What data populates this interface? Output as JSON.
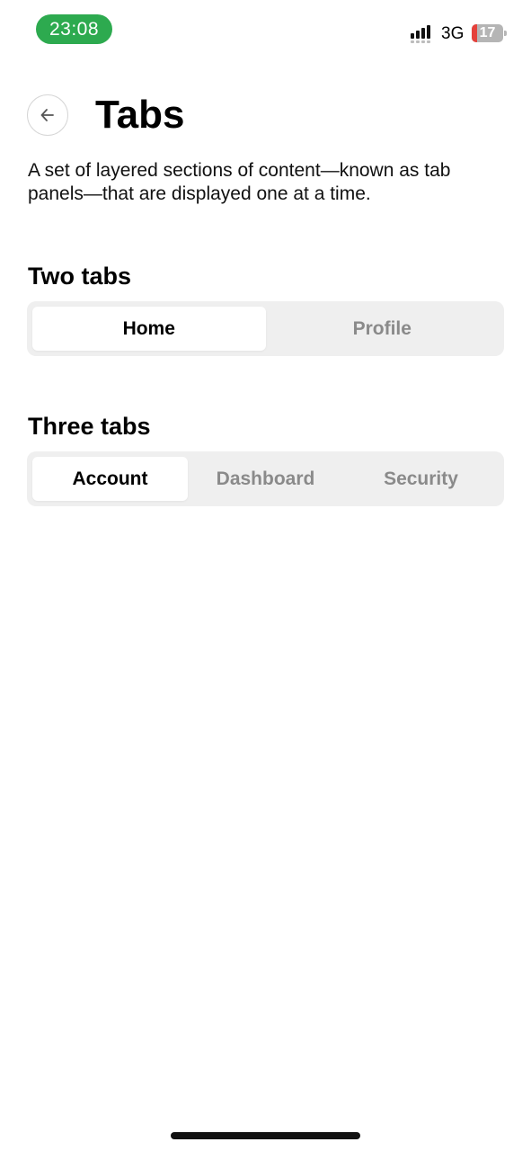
{
  "status_bar": {
    "time": "23:08",
    "network": "3G",
    "battery_level": "17",
    "battery_fraction": 0.17,
    "colors": {
      "time_pill": "#2daa4f",
      "battery_low": "#e5413b"
    }
  },
  "header": {
    "back_icon": "arrow-left-icon",
    "title": "Tabs"
  },
  "description": "A set of layered sections of content—known as tab panels—that are displayed one at a time.",
  "two_tabs": {
    "title": "Two tabs",
    "tabs": [
      {
        "label": "Home",
        "selected": true
      },
      {
        "label": "Profile",
        "selected": false
      }
    ]
  },
  "three_tabs": {
    "title": "Three tabs",
    "tabs": [
      {
        "label": "Account",
        "selected": true
      },
      {
        "label": "Dashboard",
        "selected": false
      },
      {
        "label": "Security",
        "selected": false
      }
    ]
  }
}
